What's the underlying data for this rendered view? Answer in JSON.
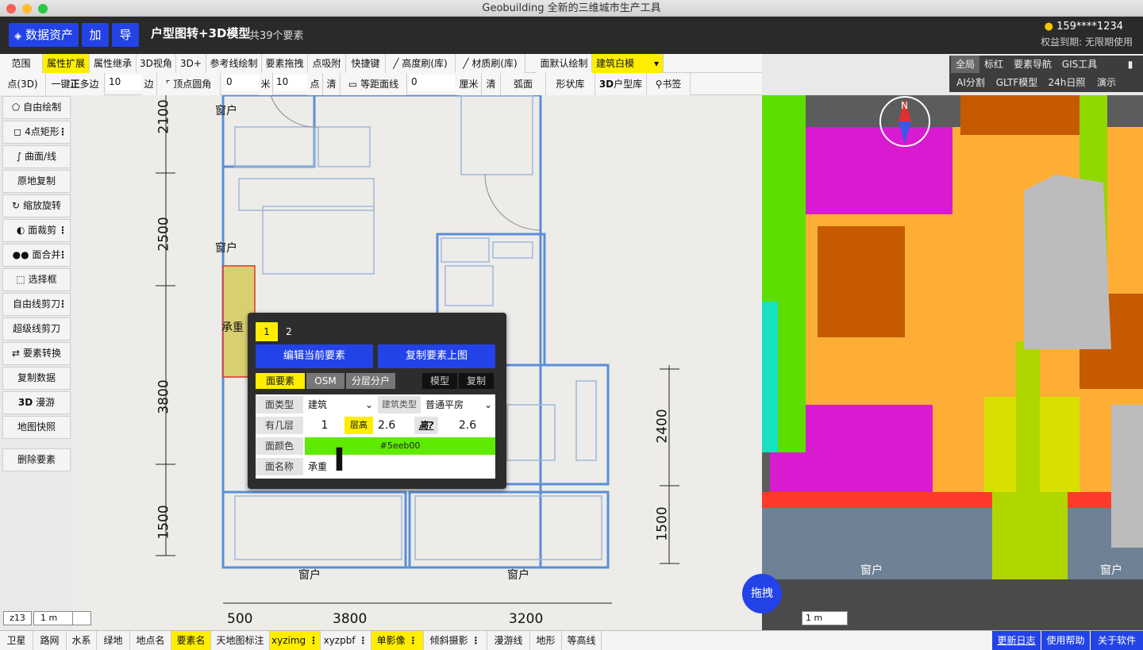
{
  "window": {
    "title": "Geobuilding 全新的三维城市生产工具"
  },
  "header": {
    "assets_label": "数据资产",
    "add_label": "加",
    "export_label": "导",
    "title": "户型图转+3D模型",
    "count": "共39个要素",
    "user": "159****1234",
    "rights": "权益到期: 无限期使用"
  },
  "toolbar1": [
    "范围",
    "属性扩展",
    "属性继承",
    "3D视角",
    "3D+",
    "参考线绘制",
    "要素拖拽",
    "点吸附",
    "快捷键",
    "高度刷(库)",
    "材质刷(库)",
    "面默认绘制",
    "建筑白模"
  ],
  "toolbar2": {
    "point3d": "点(3D)",
    "one_key": "一键",
    "zheng": "正",
    "polygon": "多边",
    "sides_value": "10",
    "sides_unit": "边",
    "corner": "顶点圆角",
    "corner_value": "0",
    "corner_unit": "米",
    "points_value": "10",
    "points_unit": "点",
    "clear": "清",
    "equidistant": "等距面线",
    "equi_value": "0",
    "equi_unit": "厘米",
    "clear2": "清",
    "arc": "弧面",
    "shape_lib": "形状库",
    "lib3d_bold": "3D",
    "lib3d": "户型库",
    "bookmark": "书签"
  },
  "right_tabs": [
    "全局",
    "标红",
    "要素导航",
    "GIS工具",
    "AI分割",
    "GLTF模型",
    "24h日照",
    "演示"
  ],
  "sidebar": [
    {
      "label": "自由绘制",
      "icon": "polygon-icon",
      "more": false
    },
    {
      "label": "4点矩形",
      "icon": "rectangle-icon",
      "more": true
    },
    {
      "label": "曲面/线",
      "icon": "curve-icon",
      "more": false
    },
    {
      "label": "原地复制",
      "icon": "",
      "more": false
    },
    {
      "label": "缩放旋转",
      "icon": "rotate-icon",
      "more": false
    },
    {
      "label": "面裁剪",
      "icon": "clip-icon",
      "more": true
    },
    {
      "label": "面合并",
      "icon": "merge-icon",
      "more": true
    },
    {
      "label": "选择框",
      "icon": "select-box-icon",
      "more": false
    },
    {
      "label": "自由线剪刀",
      "icon": "",
      "more": true
    },
    {
      "label": "超级线剪刀",
      "icon": "",
      "more": false
    },
    {
      "label": "要素转换",
      "icon": "convert-icon",
      "more": false
    },
    {
      "label": "复制数据",
      "icon": "",
      "more": false
    },
    {
      "label": "漫游",
      "icon": "",
      "more": false
    },
    {
      "label": "地图快照",
      "icon": "",
      "more": false
    },
    {
      "label": "删除要素",
      "icon": "",
      "more": false
    }
  ],
  "sidebar_3d_prefix": "3D",
  "plan": {
    "dims_left": [
      "2100",
      "2500",
      "3800",
      "1500"
    ],
    "dims_right": [
      "2400",
      "1500"
    ],
    "dims_bottom": [
      "500",
      "3800",
      "3200"
    ],
    "window_label": "窗户",
    "bearing_label": "承重"
  },
  "popup": {
    "tabs": [
      "1",
      "2"
    ],
    "edit_button": "编辑当前要素",
    "copy_button": "复制要素上图",
    "subtabs": [
      "面要素",
      "OSM",
      "分层分户"
    ],
    "model": "模型",
    "copy": "复制",
    "face_type_label": "面类型",
    "face_type_value": "建筑",
    "building_type_label": "建筑类型",
    "building_type_value": "普通平房",
    "floors_label": "有几层",
    "floors_value": "1",
    "floor_height_label": "层高",
    "floor_height_value": "2.6",
    "height_label": "高?",
    "height_value": "2.6",
    "color_label": "面颜色",
    "color_value": "#5eeb00",
    "name_label": "面名称",
    "name_value": "承重"
  },
  "colors": {
    "accent": "#2343e8",
    "highlight": "#ffee00",
    "face": "#5eeb00"
  },
  "scale": {
    "zoom": "z13",
    "left": "1 m",
    "right": "1 m"
  },
  "drag_button": "拖拽",
  "bottom_left": [
    "卫星",
    "路网",
    "水系",
    "绿地",
    "地点名",
    "要素名",
    "天地图标注",
    "xyzimg",
    "xyzpbf",
    "单影像",
    "倾斜摄影",
    "漫游线",
    "地形",
    "等高线"
  ],
  "bottom_right": [
    "更新日志",
    "使用帮助",
    "关于软件"
  ]
}
